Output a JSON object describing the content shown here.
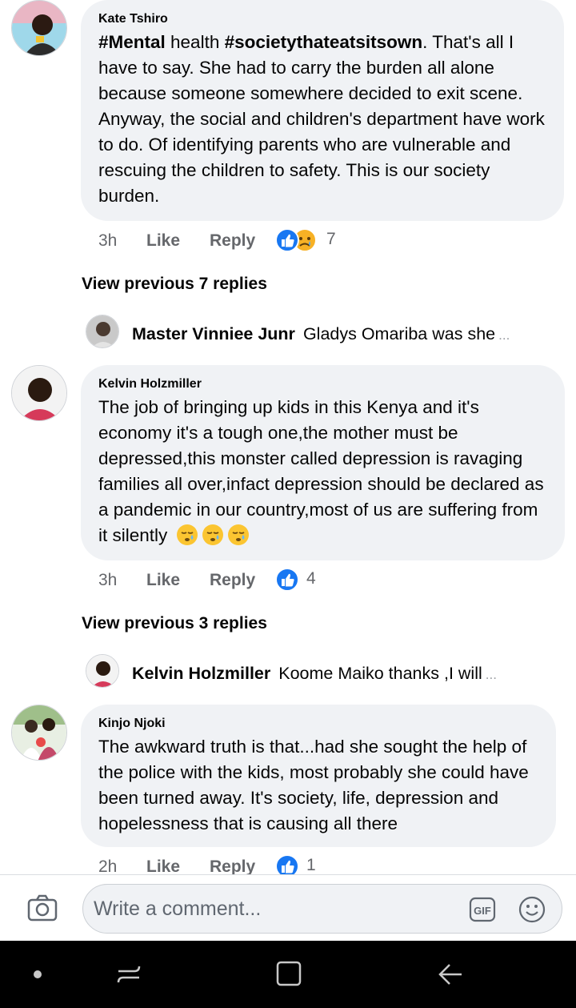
{
  "comments": [
    {
      "author": "Kate Tshiro",
      "text_parts": [
        {
          "t": "#Mental",
          "b": true
        },
        {
          "t": " health ",
          "b": false
        },
        {
          "t": "#societythateatsitsown",
          "b": true
        },
        {
          "t": ". That's all I have to say. She had to carry the burden all alone because someone somewhere decided to exit scene. Anyway, the social and children's department have work to do. Of identifying parents who are vulnerable and rescuing the children to safety. This is our society burden.",
          "b": false
        }
      ],
      "time": "3h",
      "like": "Like",
      "reply": "Reply",
      "reactions": [
        "like",
        "sad"
      ],
      "reaction_count": "7",
      "view_previous": "View previous 7 replies",
      "latest_reply": {
        "author": "Master Vinniee Junr",
        "text": "Gladys Omariba was she",
        "ellipsis": "..."
      }
    },
    {
      "author": "Kelvin Holzmiller",
      "text": "The job of bringing up kids in this Kenya and it's economy it's a tough one,the mother must be depressed,this monster called depression is ravaging families all over,infact depression should be declared as a pandemic in our country,most of us are suffering from it silently",
      "emoji": [
        "sleepy",
        "sleepy",
        "sleepy"
      ],
      "time": "3h",
      "like": "Like",
      "reply": "Reply",
      "reactions": [
        "like"
      ],
      "reaction_count": "4",
      "view_previous": "View previous 3 replies",
      "latest_reply": {
        "author": "Kelvin Holzmiller",
        "text": "Koome Maiko thanks ,I will",
        "ellipsis": "..."
      }
    },
    {
      "author": "Kinjo Njoki",
      "text": "The awkward truth is that...had she sought the help of the police with the kids, most probably she could have been turned away. It's society, life, depression and hopelessness that is causing all there",
      "time": "2h",
      "like": "Like",
      "reply": "Reply",
      "reactions": [
        "like"
      ],
      "reaction_count": "1"
    }
  ],
  "composer": {
    "placeholder": "Write a comment...",
    "icons": [
      "camera-icon",
      "gif-icon",
      "emoji-icon"
    ]
  },
  "navbar": {
    "icons": [
      "dot-icon",
      "recent-apps-icon",
      "home-icon",
      "back-icon"
    ]
  },
  "colors": {
    "bubble": "#f0f2f5",
    "like_blue": "#1877f2",
    "sad_yellow": "#f7b125",
    "meta_gray": "#65676b",
    "navbar": "#000000"
  }
}
